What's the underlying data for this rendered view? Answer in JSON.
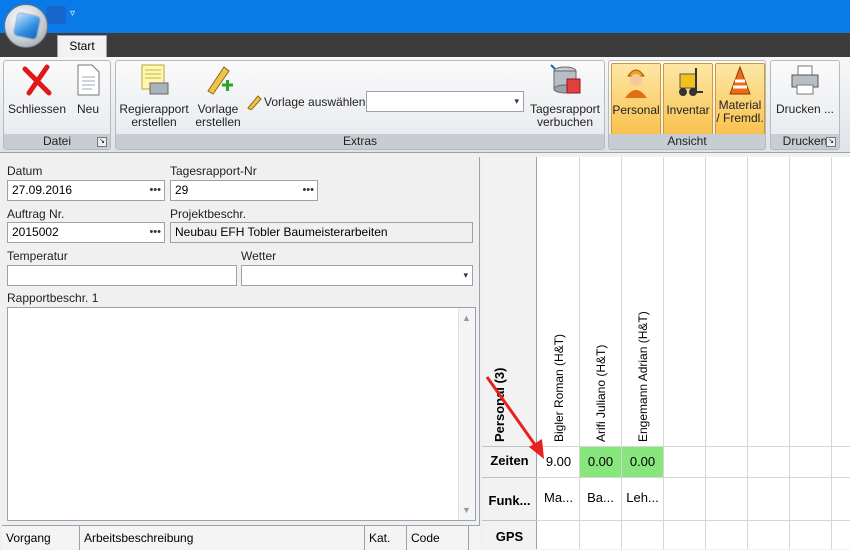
{
  "tabs": [
    "Start"
  ],
  "ribbon": {
    "groups": [
      {
        "label": "Datei",
        "buttons": [
          {
            "label": "Schliessen",
            "icon": "close-x-icon"
          },
          {
            "label": "Neu",
            "icon": "new-document-icon"
          }
        ]
      },
      {
        "label": "Extras",
        "buttons": [
          {
            "label1": "Regierapport",
            "label2": "erstellen",
            "icon": "report-printer-icon"
          },
          {
            "label1": "Vorlage",
            "label2": "erstellen",
            "icon": "pencil-plus-icon"
          },
          {
            "label1": "Tagesrapport",
            "label2": "verbuchen",
            "icon": "database-post-icon"
          }
        ],
        "template_label": "Vorlage auswählen",
        "template_value": ""
      },
      {
        "label": "Ansicht",
        "buttons": [
          {
            "label": "Personal",
            "icon": "worker-icon",
            "active": true
          },
          {
            "label": "Inventar",
            "icon": "forklift-icon",
            "active": true
          },
          {
            "label1": "Material",
            "label2": "/ Fremdl.",
            "icon": "traffic-cone-icon",
            "active": true
          }
        ]
      },
      {
        "label": "Drucken",
        "buttons": [
          {
            "label": "Drucken ...",
            "icon": "printer-icon"
          }
        ]
      }
    ]
  },
  "form": {
    "datum_label": "Datum",
    "datum_value": "27.09.2016",
    "tagesrapport_label": "Tagesrapport-Nr",
    "tagesrapport_value": "29",
    "auftrag_label": "Auftrag Nr.",
    "auftrag_value": "2015002",
    "projekt_label": "Projektbeschr.",
    "projekt_value": "Neubau EFH Tobler Baumeisterarbeiten",
    "temperatur_label": "Temperatur",
    "temperatur_value": "",
    "wetter_label": "Wetter",
    "wetter_value": "",
    "rapport_label": "Rapportbeschr. 1",
    "rapport_value": ""
  },
  "grid_columns": [
    "Vorgang",
    "Arbeitsbeschreibung",
    "Kat.",
    "Code"
  ],
  "personal": {
    "header": "Personal (3)",
    "rows": [
      "Zeiten",
      "Funk...",
      "GPS"
    ],
    "columns": [
      {
        "name": "Bigler Roman (H&T)",
        "zeiten": "9.00",
        "funk": "Ma...",
        "zeiten_green": false
      },
      {
        "name": "Arifi Juliano (H&T)",
        "zeiten": "0.00",
        "funk": "Ba...",
        "zeiten_green": true
      },
      {
        "name": "Engemann Adrian (H&T)",
        "zeiten": "0.00",
        "funk": "Leh...",
        "zeiten_green": true
      }
    ]
  },
  "colors": {
    "titlebar": "#0a7ae8",
    "green_cell": "#87e77d",
    "active_button": "#f9c24f",
    "annotation_arrow": "#e8201f"
  }
}
